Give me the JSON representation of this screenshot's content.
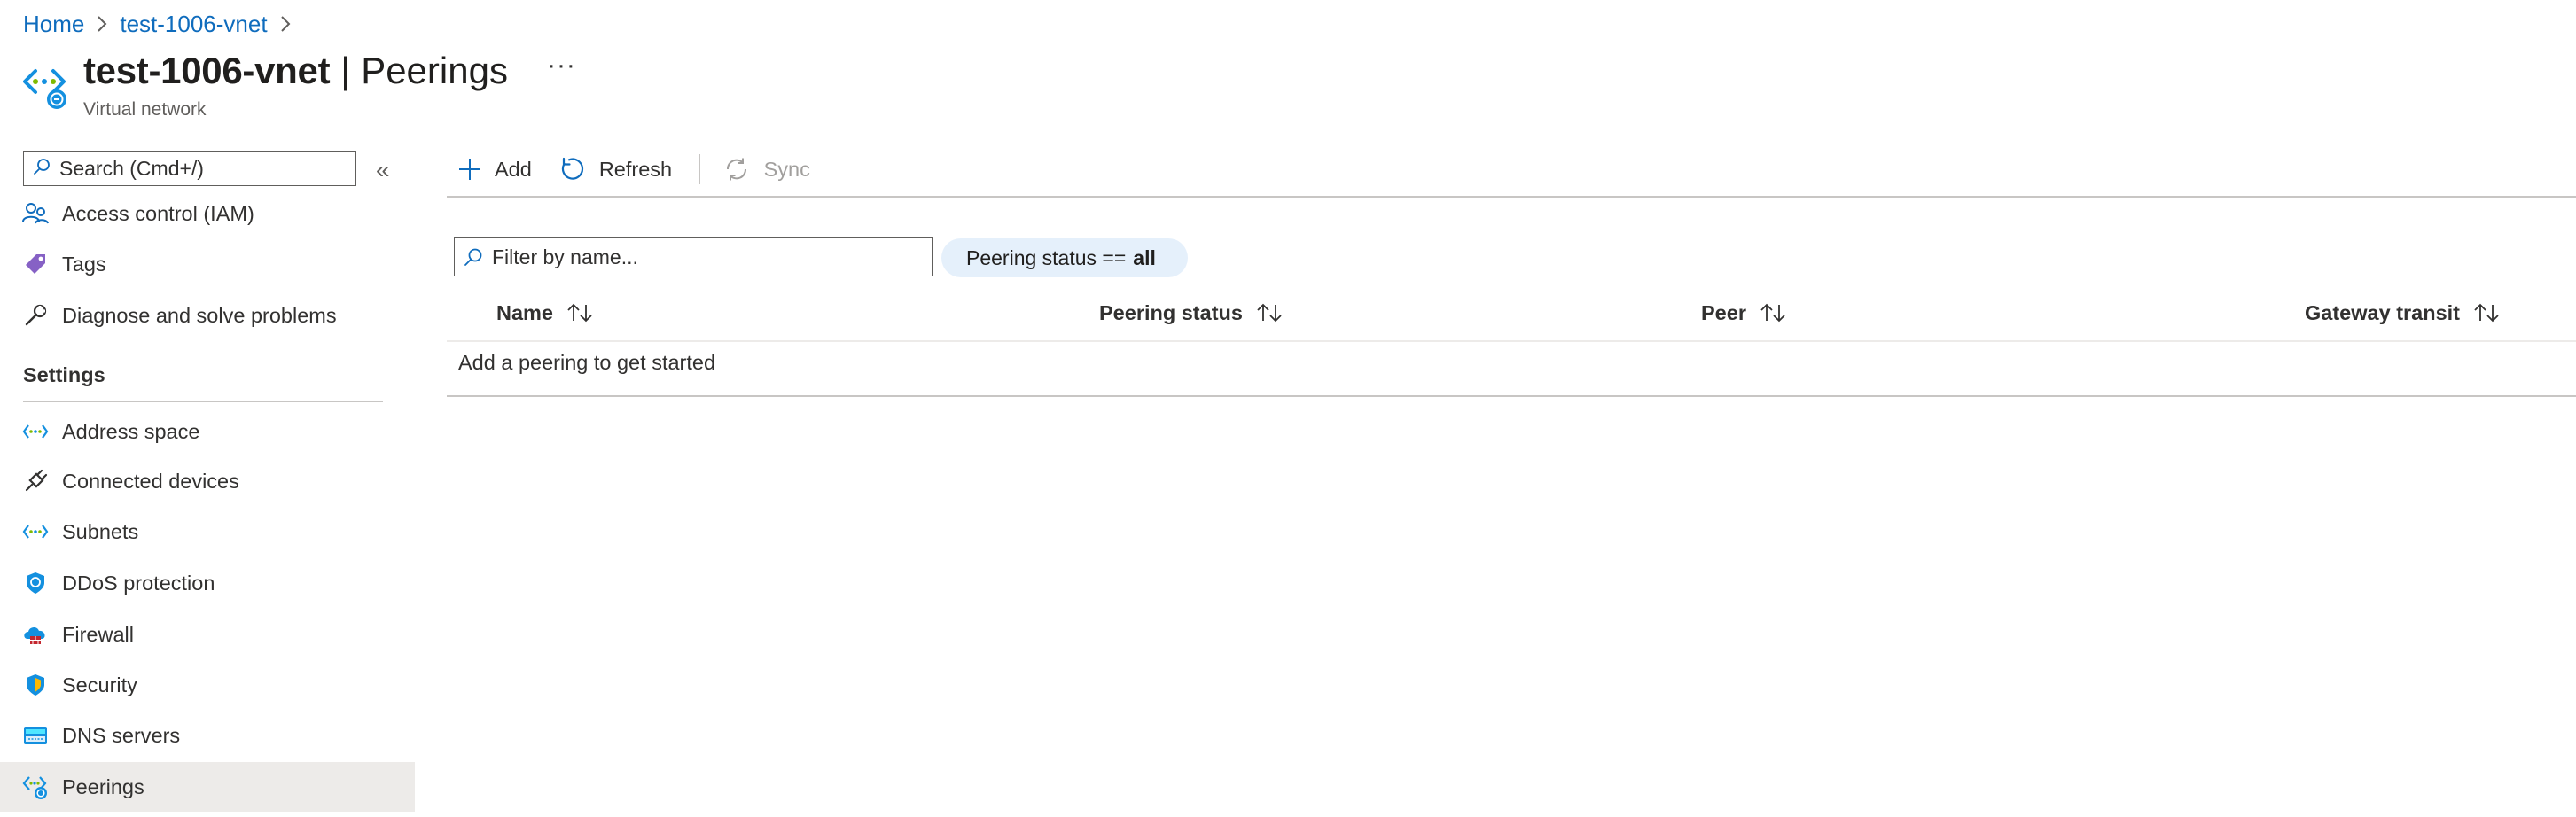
{
  "breadcrumb": {
    "items": [
      "Home",
      "test-1006-vnet"
    ]
  },
  "header": {
    "resource_name": "test-1006-vnet",
    "separator": "|",
    "blade_title": "Peerings",
    "more_label": "···",
    "resource_type": "Virtual network",
    "icon": "virtual-network-peering-icon"
  },
  "sidebar": {
    "search_placeholder": "Search (Cmd+/)",
    "collapse_label": "«",
    "items_top": [
      {
        "label": "Access control (IAM)",
        "icon": "iam-icon"
      },
      {
        "label": "Tags",
        "icon": "tag-icon"
      },
      {
        "label": "Diagnose and solve problems",
        "icon": "wrench-icon"
      }
    ],
    "section_title": "Settings",
    "items_settings": [
      {
        "label": "Address space",
        "icon": "vnet-icon"
      },
      {
        "label": "Connected devices",
        "icon": "plug-icon"
      },
      {
        "label": "Subnets",
        "icon": "vnet-icon"
      },
      {
        "label": "DDoS protection",
        "icon": "shield-icon"
      },
      {
        "label": "Firewall",
        "icon": "firewall-icon"
      },
      {
        "label": "Security",
        "icon": "security-shield-icon"
      },
      {
        "label": "DNS servers",
        "icon": "dns-icon"
      },
      {
        "label": "Peerings",
        "icon": "peering-icon",
        "active": true
      }
    ]
  },
  "toolbar": {
    "add_label": "Add",
    "refresh_label": "Refresh",
    "sync_label": "Sync"
  },
  "filter": {
    "placeholder": "Filter by name...",
    "pill_prefix": "Peering status ==",
    "pill_value": "all"
  },
  "table": {
    "columns": [
      "Name",
      "Peering status",
      "Peer",
      "Gateway transit"
    ],
    "rows": [],
    "empty_message": "Add a peering to get started"
  },
  "colors": {
    "accent": "#0f6cbd",
    "active_nav_bg": "#edebe9",
    "pill_bg": "#e5f0fb",
    "azure_blue": "#1490df",
    "tag_purple": "#8661c5",
    "firewall_red": "#c4262e"
  }
}
